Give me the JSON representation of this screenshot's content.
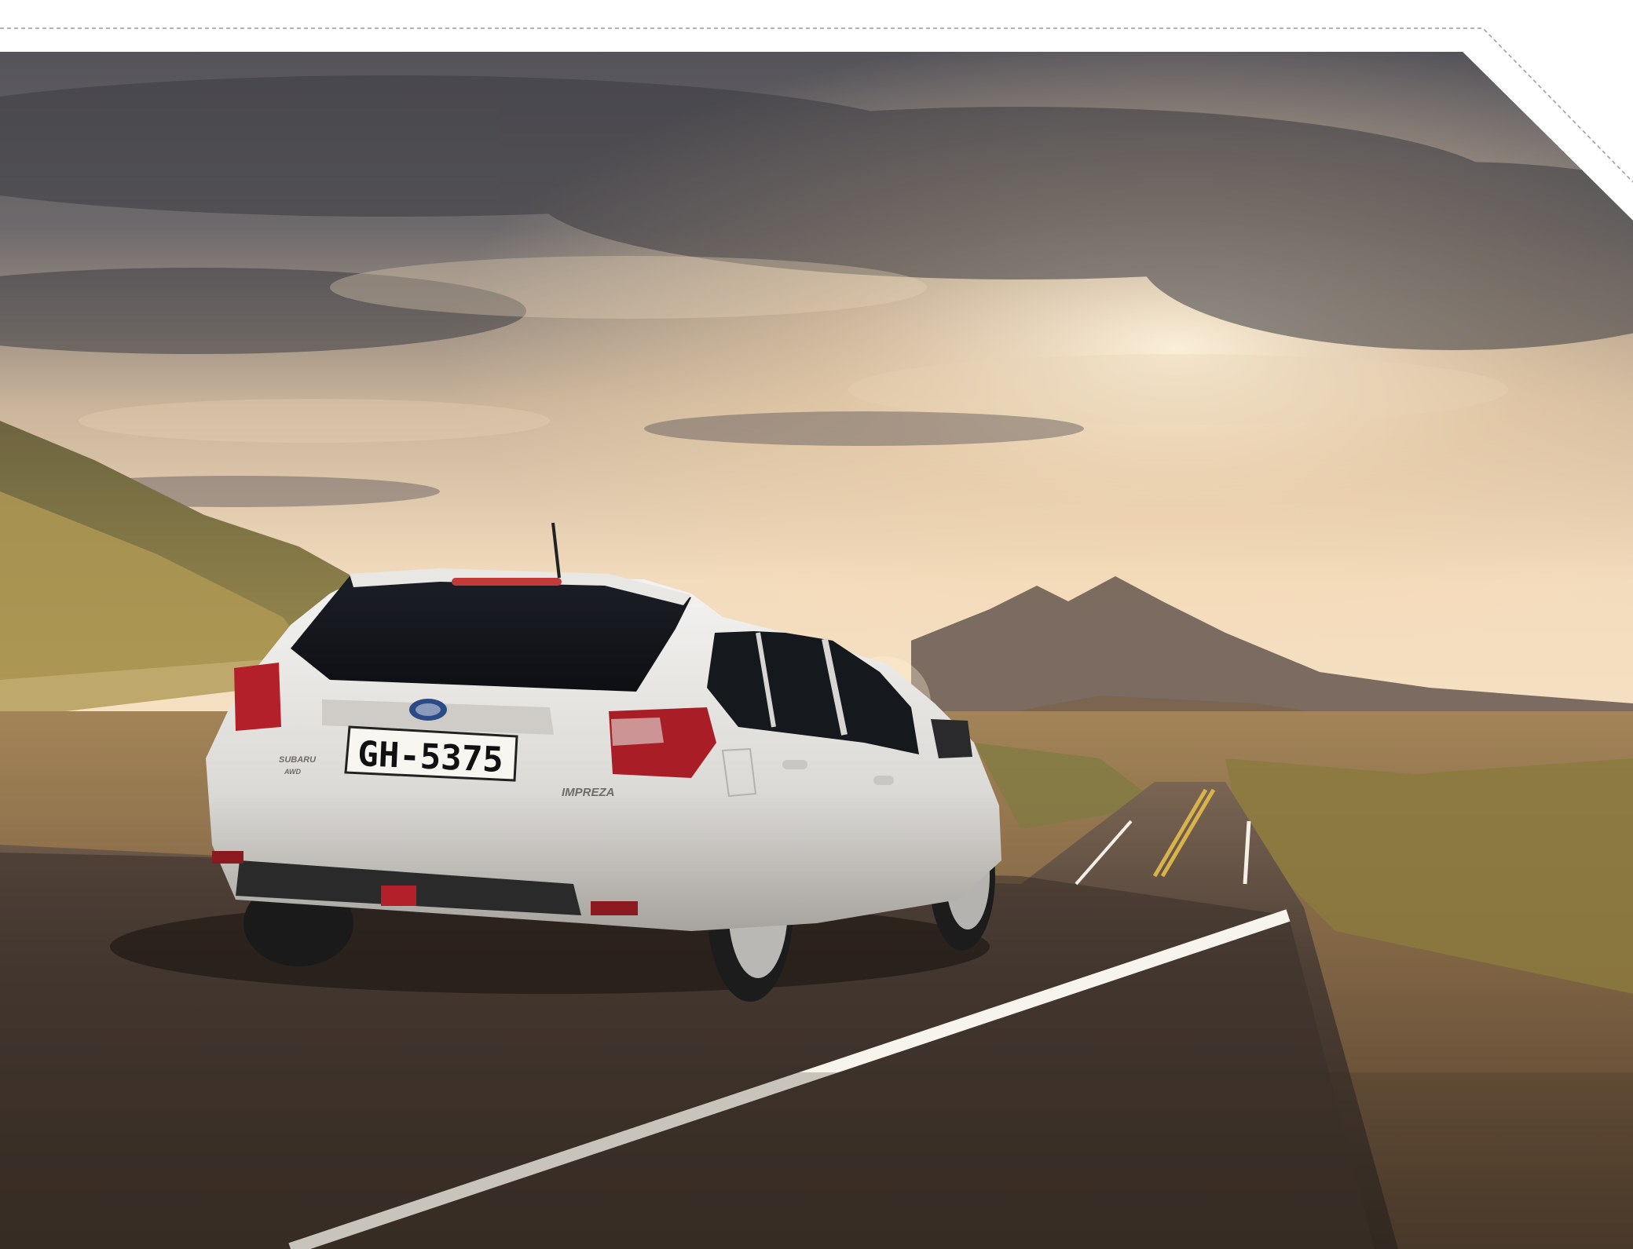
{
  "photo": {
    "license_plate": "GH-5375",
    "model_badge": "IMPREZA",
    "brand_badge": "SUBARU",
    "drive_badge": "AWD"
  },
  "colors": {
    "car_body": "#e8e6e2",
    "sky_top": "#4a4a52",
    "sky_glow": "#f2d9b5",
    "road": "#3b332c",
    "taillight": "#b3202a"
  }
}
